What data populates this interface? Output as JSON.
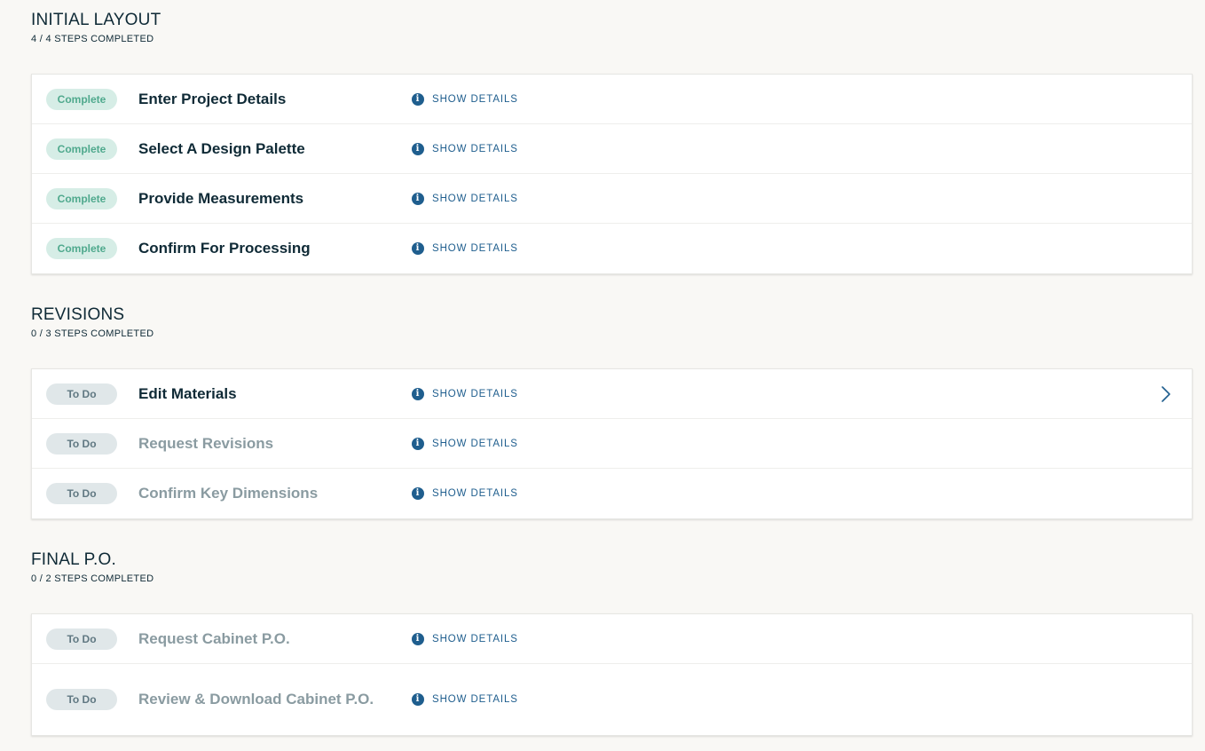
{
  "sections": [
    {
      "title": "INITIAL LAYOUT",
      "progress": "4 / 4 STEPS COMPLETED",
      "steps": [
        {
          "status": "Complete",
          "title": "Enter Project Details",
          "details": "SHOW DETAILS"
        },
        {
          "status": "Complete",
          "title": "Select A Design Palette",
          "details": "SHOW DETAILS"
        },
        {
          "status": "Complete",
          "title": "Provide Measurements",
          "details": "SHOW DETAILS"
        },
        {
          "status": "Complete",
          "title": "Confirm For Processing",
          "details": "SHOW DETAILS"
        }
      ]
    },
    {
      "title": "REVISIONS",
      "progress": "0 / 3 STEPS COMPLETED",
      "steps": [
        {
          "status": "To Do",
          "title": "Edit Materials",
          "details": "SHOW DETAILS"
        },
        {
          "status": "To Do",
          "title": "Request Revisions",
          "details": "SHOW DETAILS"
        },
        {
          "status": "To Do",
          "title": "Confirm Key Dimensions",
          "details": "SHOW DETAILS"
        }
      ]
    },
    {
      "title": "FINAL P.O.",
      "progress": "0 / 2 STEPS COMPLETED",
      "steps": [
        {
          "status": "To Do",
          "title": "Request Cabinet P.O.",
          "details": "SHOW DETAILS"
        },
        {
          "status": "To Do",
          "title": "Review & Download Cabinet P.O.",
          "details": "SHOW DETAILS"
        }
      ]
    }
  ],
  "icons": {
    "info": "info-icon",
    "info_glyph": "i",
    "next_step": "chevron-right-icon"
  },
  "colors": {
    "background": "#f9f8f5",
    "complete_badge_bg": "#d6ede6",
    "complete_badge_text": "#4fa98d",
    "todo_badge_bg": "#e0e7e9",
    "todo_badge_text": "#607882",
    "link": "#1f5e8e",
    "active_title": "#0f2a36",
    "disabled_title": "#8a9ba1"
  }
}
